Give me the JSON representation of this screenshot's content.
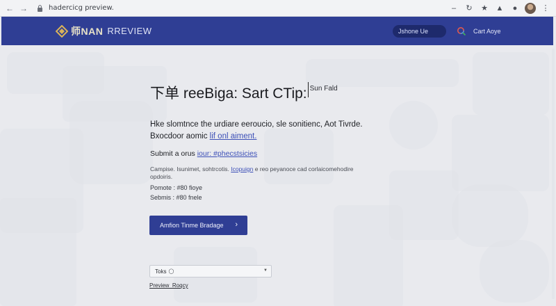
{
  "browser": {
    "url": "hadercicg preview."
  },
  "header": {
    "logo_name": "师NAN",
    "logo_sub": "RREVIEW",
    "search_value": "Jshone Ue",
    "link": "Cart Aoye"
  },
  "main": {
    "title": "下单 reeBiga: Sart CTip:",
    "title_sup": "Sun Fald",
    "para1": "Hke slomtnce the urdiare eeroucio, sle sonitienc, Aot Tivrde.",
    "para2_text": "Bxocdoor aomic",
    "para2_link": "lif onl aiment.",
    "para3_text": "Submit a orus",
    "para3_link": "iour: #phecstsicies",
    "meta_text1": "Campise. Isunimet, sohtrcotis.",
    "meta_link": "Icopuign",
    "meta_text2": "e reo peyanoce cad corlaicomehodire opdoiris.",
    "row1": "Pomote : #80 fioye",
    "row2": "Sebmis : #80 fnele",
    "cta_label": "Amfion Tinme Bradage",
    "select_value": "Toks",
    "footer_link": "Preview_Roqcy"
  },
  "colors": {
    "header_bg": "#2f3e94",
    "link": "#3c4fb7"
  },
  "icons": {
    "back": "arrow-left-icon",
    "forward": "arrow-right-icon",
    "lock": "lock-icon",
    "refresh": "refresh-icon",
    "star": "star-icon",
    "puzzle": "extension-icon",
    "menu": "kebab-menu-icon",
    "search": "search-icon",
    "chevron": "chevron-right-icon",
    "caret": "caret-down-icon"
  }
}
